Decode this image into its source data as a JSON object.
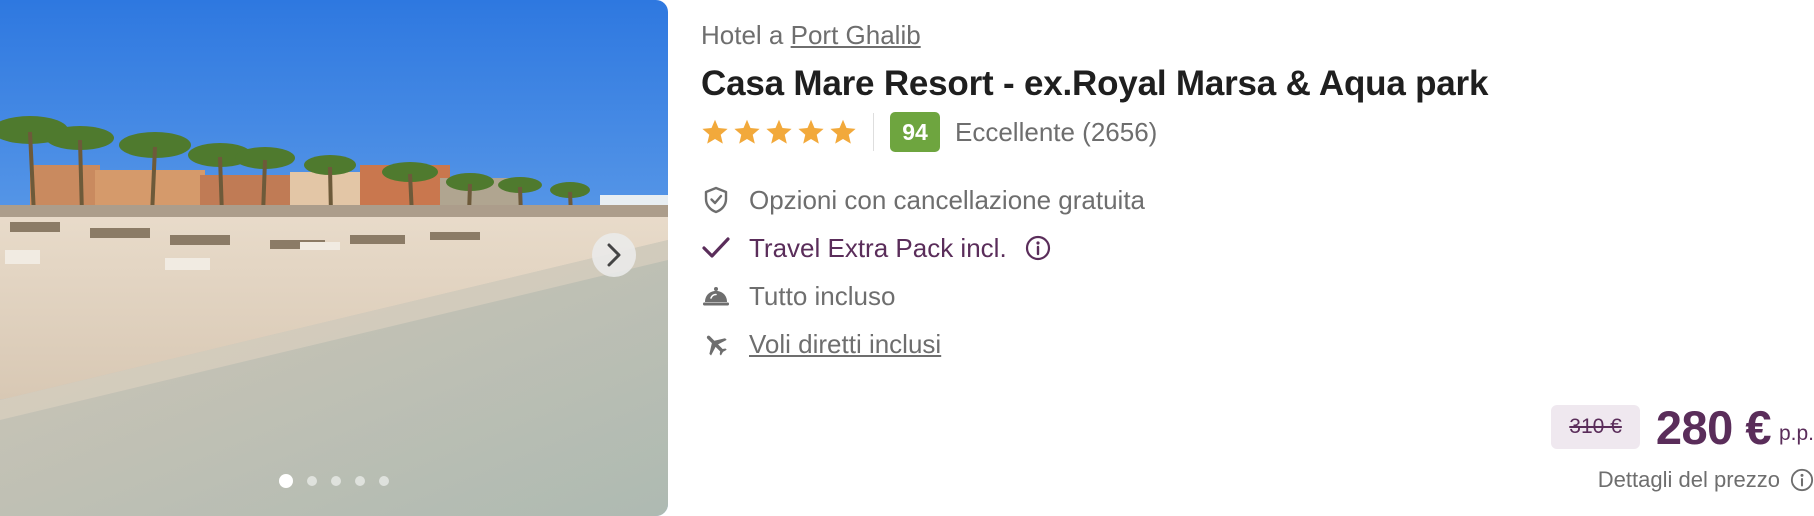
{
  "hotel": {
    "location_prefix": "Hotel a",
    "location_city": "Port Ghalib",
    "name": "Casa Mare Resort - ex.Royal Marsa & Aqua park",
    "stars": 5,
    "score": "94",
    "score_label": "Eccellente (2656)"
  },
  "gallery": {
    "total_images": 5,
    "active_index": 0,
    "next_icon": "chevron-right-icon"
  },
  "features": [
    {
      "icon": "shield-check-icon",
      "text": "Opzioni con cancellazione gratuita"
    },
    {
      "icon": "checkmark-icon",
      "text": "Travel Extra Pack incl.",
      "info_icon": "info-icon"
    },
    {
      "icon": "cloche-icon",
      "text": "Tutto incluso"
    },
    {
      "icon": "airplane-icon",
      "text": "Voli diretti inclusi"
    }
  ],
  "price": {
    "old": "310 €",
    "current": "280 €",
    "unit": "p.p.",
    "details_label": "Dettagli del prezzo",
    "details_icon": "info-icon"
  },
  "colors": {
    "brand_purple": "#5a2d5a",
    "score_green": "#6ea53f",
    "star_orange": "#f2a93b",
    "muted_text": "#6e6e6e"
  }
}
